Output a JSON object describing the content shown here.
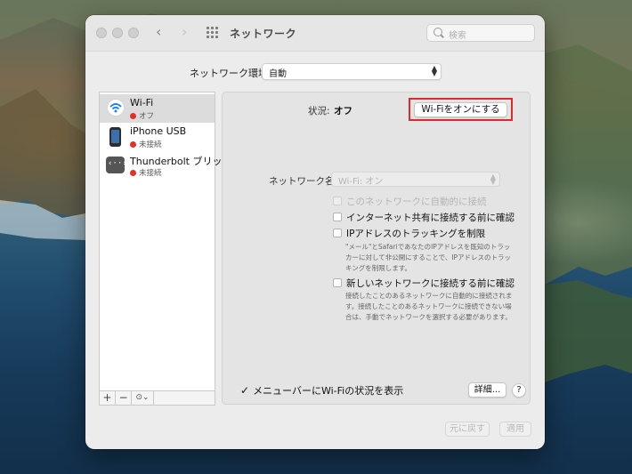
{
  "window": {
    "title": "ネットワーク"
  },
  "toolbar": {
    "search_placeholder": "検索"
  },
  "location": {
    "label": "ネットワーク環境:",
    "value": "自動"
  },
  "services": [
    {
      "name": "Wi-Fi",
      "status": "オフ",
      "icon": "wifi-icon",
      "selected": true
    },
    {
      "name": "iPhone USB",
      "status": "未接続",
      "icon": "iphone-icon",
      "selected": false
    },
    {
      "name": "Thunderbolt ブリッジ",
      "status": "未接続",
      "icon": "thunderbolt-bridge-icon",
      "selected": false
    }
  ],
  "sidebar_controls": {
    "add": "+",
    "remove": "−",
    "action": "⊙⌄"
  },
  "detail": {
    "status_label": "状況:",
    "status_value": "オフ",
    "turn_on_button": "Wi-Fiをオンにする",
    "network_name_label": "ネットワーク名:",
    "network_name_value": "Wi-Fi: オン",
    "auto_join": "このネットワークに自動的に接続",
    "ask_hotspot": "インターネット共有に接続する前に確認",
    "limit_ip_tracking": "IPアドレスのトラッキングを制限",
    "limit_ip_help": "\"メール\"とSafariであなたのIPアドレスを既知のトラッカーに対して非公開にすることで、IPアドレスのトラッキングを制限します。",
    "ask_new_networks": "新しいネットワークに接続する前に確認",
    "ask_new_help": "接続したことのあるネットワークに自動的に接続されます。接続したことのあるネットワークに接続できない場合は、手動でネットワークを選択する必要があります。",
    "show_in_menubar": "メニューバーにWi-Fiの状況を表示",
    "advanced_button": "詳細...",
    "help_button": "?"
  },
  "footer": {
    "revert": "元に戻す",
    "apply": "適用"
  },
  "colors": {
    "highlight": "#e02a2a",
    "status_red": "#e0302a",
    "wifi_blue": "#1a82f0"
  }
}
